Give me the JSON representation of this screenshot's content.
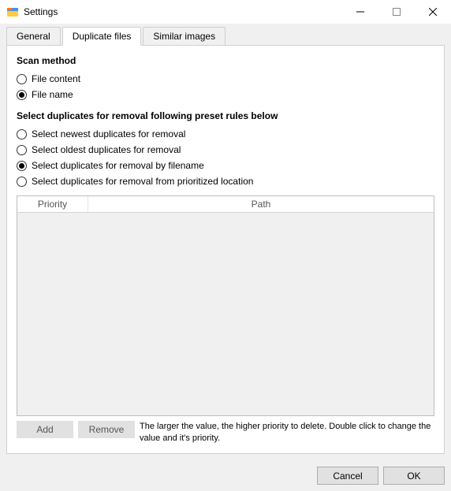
{
  "titlebar": {
    "title": "Settings"
  },
  "tabs": {
    "general": "General",
    "duplicate_files": "Duplicate files",
    "similar_images": "Similar images"
  },
  "scan_method": {
    "title": "Scan method",
    "file_content": "File content",
    "file_name": "File name"
  },
  "preset": {
    "title": "Select duplicates for removal following preset rules below",
    "newest": "Select newest duplicates for removal",
    "oldest": "Select oldest duplicates for removal",
    "by_filename": "Select duplicates for removal by filename",
    "by_location": "Select duplicates for removal from prioritized location"
  },
  "table": {
    "col_priority": "Priority",
    "col_path": "Path"
  },
  "actions": {
    "add": "Add",
    "remove": "Remove",
    "hint": "The larger the value, the higher priority to delete. Double click to change the value and it's priority."
  },
  "footer": {
    "cancel": "Cancel",
    "ok": "OK"
  }
}
